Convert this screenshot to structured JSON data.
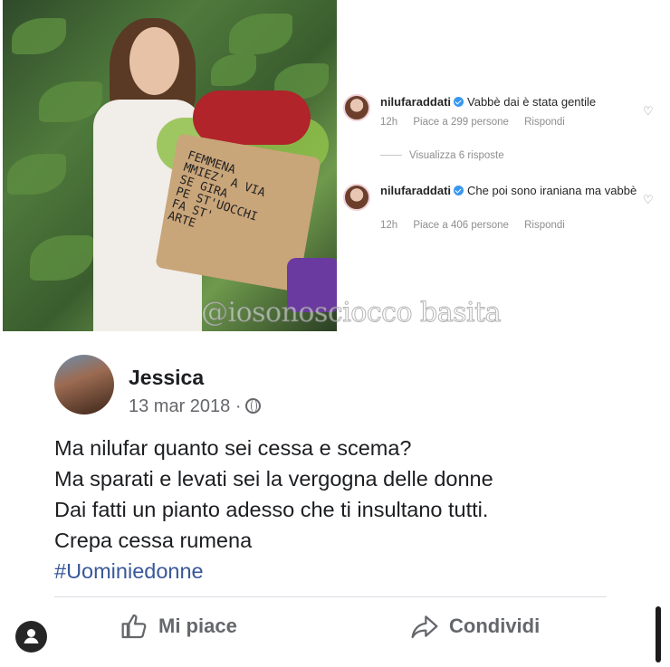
{
  "photo": {
    "bouquet_lines": [
      "FEMMENA",
      "MMIEZ' A VIA",
      "SE GIRA",
      "PE ST'UOCCHI",
      "FA ST'",
      "ARTE"
    ]
  },
  "watermark": "@iosonosciocco basita",
  "comments": [
    {
      "username": "nilufaraddati",
      "text": "Vabbè dai è stata gentile",
      "time": "12h",
      "likes": "Piace a 299 persone",
      "reply": "Rispondi"
    },
    {
      "username": "nilufaraddati",
      "text": "Che poi sono iraniana ma vabbè",
      "time": "12h",
      "likes": "Piace a 406 persone",
      "reply": "Rispondi"
    }
  ],
  "view_replies": "Visualizza 6 risposte",
  "fb_post": {
    "author": "Jessica",
    "date": "13 mar 2018 ·",
    "lines": [
      "Ma nilufar quanto sei cessa e scema?",
      "Ma sparati e levati sei la vergogna delle donne",
      "Dai fatti un pianto adesso che ti insultano tutti.",
      "Crepa cessa rumena"
    ],
    "hashtag": "#Uominiedonne",
    "like_label": "Mi piace",
    "share_label": "Condividi"
  },
  "colors": {
    "fb_text": "#1c1e21",
    "fb_muted": "#65676b",
    "hashtag": "#385898",
    "verified": "#3897f0"
  }
}
